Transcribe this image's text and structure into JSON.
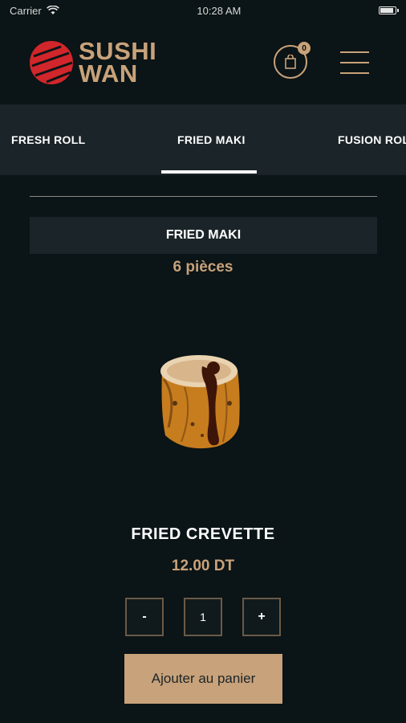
{
  "status_bar": {
    "carrier": "Carrier",
    "time": "10:28 AM"
  },
  "header": {
    "logo_line1": "SUSHI",
    "logo_line2": "WAN",
    "cart_count": "0"
  },
  "tabs": [
    {
      "label": "FRESH ROLL"
    },
    {
      "label": "FRIED MAKI"
    },
    {
      "label": "FUSION ROLL"
    }
  ],
  "active_tab": "FRIED MAKI",
  "section": {
    "title": "FRIED MAKI",
    "pieces": "6 pièces"
  },
  "product": {
    "name": "FRIED CREVETTE",
    "price": "12.00 DT",
    "quantity": "1",
    "minus_label": "-",
    "plus_label": "+",
    "add_to_cart_label": "Ajouter au panier"
  },
  "colors": {
    "background": "#0b1416",
    "panel": "#1b2428",
    "accent": "#c8a27a",
    "logo_red": "#d1262b"
  },
  "icons": {
    "cart": "shopping-bag-icon",
    "menu": "hamburger-menu-icon",
    "wifi": "wifi-icon",
    "battery": "battery-icon"
  }
}
